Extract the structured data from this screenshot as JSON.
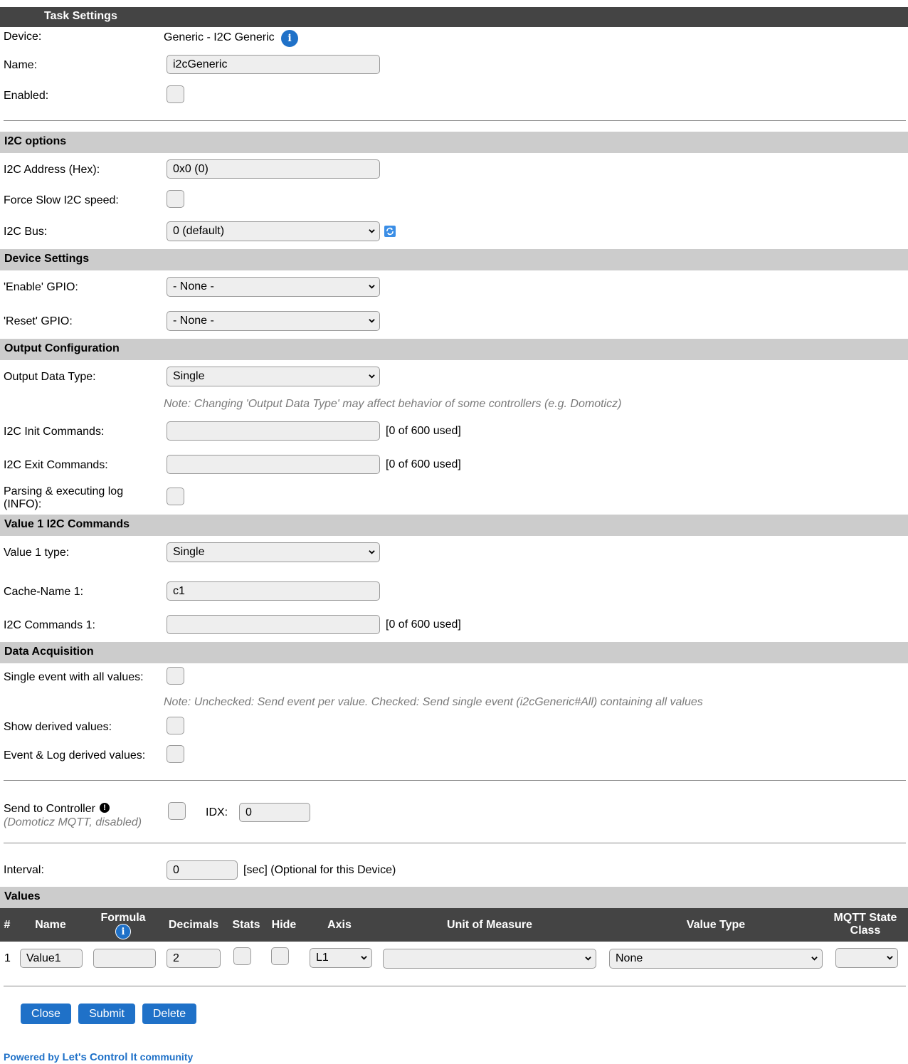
{
  "header": {
    "title": "Task Settings"
  },
  "device": {
    "label": "Device:",
    "value": "Generic - I2C Generic",
    "name_label": "Name:",
    "name_value": "i2cGeneric",
    "enabled_label": "Enabled:"
  },
  "i2c_options": {
    "title": "I2C options",
    "address_label": "I2C Address (Hex):",
    "address_value": "0x0 (0)",
    "slow_label": "Force Slow I2C speed:",
    "bus_label": "I2C Bus:",
    "bus_value": "0 (default)"
  },
  "device_settings": {
    "title": "Device Settings",
    "enable_gpio_label": "'Enable' GPIO:",
    "enable_gpio_value": "- None -",
    "reset_gpio_label": "'Reset' GPIO:",
    "reset_gpio_value": "- None -"
  },
  "output_config": {
    "title": "Output Configuration",
    "data_type_label": "Output Data Type:",
    "data_type_value": "Single",
    "note": "Note: Changing 'Output Data Type' may affect behavior of some controllers (e.g. Domoticz)",
    "init_label": "I2C Init Commands:",
    "init_used": "[0 of 600 used]",
    "exit_label": "I2C Exit Commands:",
    "exit_used": "[0 of 600 used]",
    "log_label_1": "Parsing & executing log",
    "log_label_2": "(INFO):"
  },
  "value1": {
    "title": "Value 1 I2C Commands",
    "type_label": "Value 1 type:",
    "type_value": "Single",
    "cache_label": "Cache-Name 1:",
    "cache_value": "c1",
    "cmd_label": "I2C Commands 1:",
    "cmd_used": "[0 of 600 used]"
  },
  "data_acq": {
    "title": "Data Acquisition",
    "single_event_label": "Single event with all values:",
    "note": "Note: Unchecked: Send event per value. Checked: Send single event (i2cGeneric#All) containing all values",
    "derived_label": "Show derived values:",
    "event_log_label": "Event & Log derived values:"
  },
  "controller": {
    "label": "Send to Controller",
    "sub": "(Domoticz MQTT, disabled)",
    "idx_label": "IDX:",
    "idx_value": "0"
  },
  "interval": {
    "label": "Interval:",
    "value": "0",
    "suffix": "[sec] (Optional for this Device)"
  },
  "values": {
    "title": "Values",
    "columns": {
      "num": "#",
      "name": "Name",
      "formula": "Formula",
      "decimals": "Decimals",
      "stats": "Stats",
      "hide": "Hide",
      "axis": "Axis",
      "uom": "Unit of Measure",
      "value_type": "Value Type",
      "mqtt_1": "MQTT State",
      "mqtt_2": "Class"
    },
    "rows": [
      {
        "num": "1",
        "name": "Value1",
        "formula": "",
        "decimals": "2",
        "axis": "L1",
        "uom": "",
        "value_type": "None",
        "mqtt": ""
      }
    ]
  },
  "buttons": {
    "close": "Close",
    "submit": "Submit",
    "delete": "Delete"
  },
  "footer": {
    "prefix": "Powered by ",
    "brand": "Let's Control It",
    "suffix": " community"
  },
  "colors": {
    "accent": "#1f71c8",
    "header_bg": "#444444",
    "section_bg": "#cccccc"
  }
}
